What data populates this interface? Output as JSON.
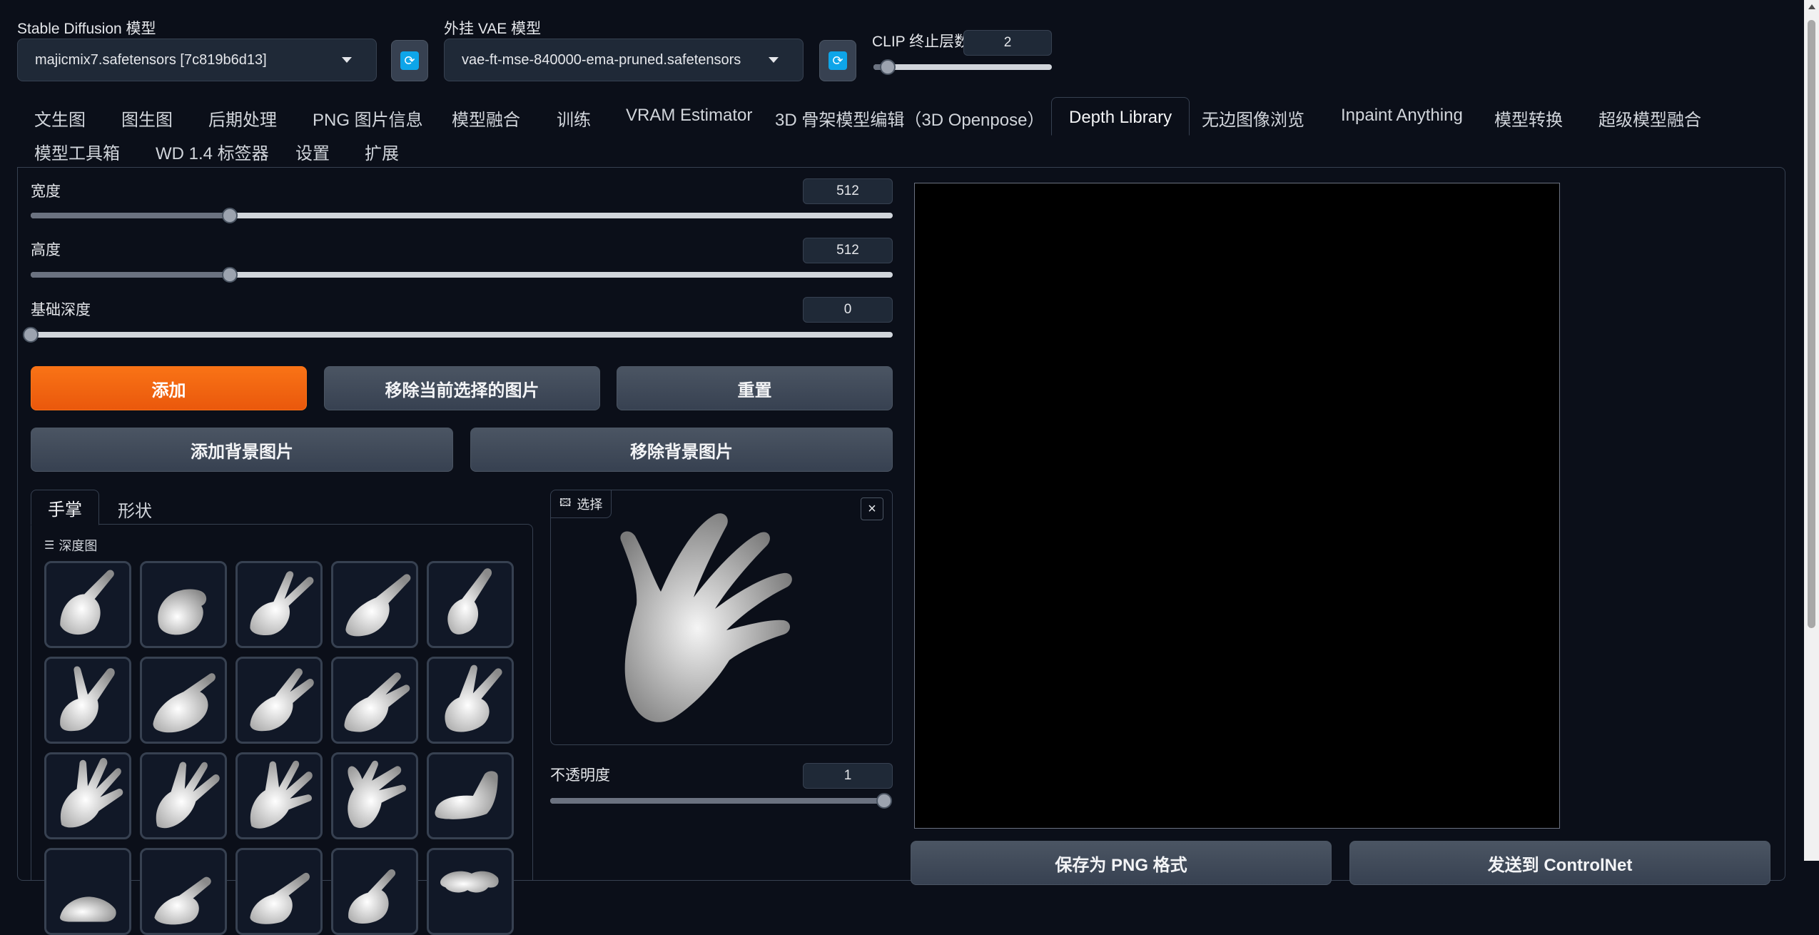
{
  "top": {
    "sd_model_label": "Stable Diffusion 模型",
    "sd_model_value": "majicmix7.safetensors [7c819b6d13]",
    "vae_label": "外挂 VAE 模型",
    "vae_value": "vae-ft-mse-840000-ema-pruned.safetensors",
    "clip_label": "CLIP 终止层数",
    "clip_value": "2",
    "clip_slider_fraction": 0.08
  },
  "tabs": [
    {
      "label": "文生图"
    },
    {
      "label": "图生图"
    },
    {
      "label": "后期处理"
    },
    {
      "label": "PNG 图片信息"
    },
    {
      "label": "模型融合"
    },
    {
      "label": "训练"
    },
    {
      "label": "VRAM Estimator"
    },
    {
      "label": "3D 骨架模型编辑（3D Openpose）"
    },
    {
      "label": "Depth Library"
    },
    {
      "label": "无边图像浏览"
    },
    {
      "label": "Inpaint Anything"
    },
    {
      "label": "模型转换"
    },
    {
      "label": "超级模型融合"
    },
    {
      "label": "模型工具箱"
    },
    {
      "label": "WD 1.4 标签器"
    },
    {
      "label": "设置"
    },
    {
      "label": "扩展"
    }
  ],
  "active_tab": "Depth Library",
  "controls": {
    "width_label": "宽度",
    "width_value": "512",
    "width_fraction": 0.231,
    "height_label": "高度",
    "height_value": "512",
    "height_fraction": 0.231,
    "base_depth_label": "基础深度",
    "base_depth_value": "0",
    "base_depth_fraction": 0.0
  },
  "buttons": {
    "add": "添加",
    "remove_selected": "移除当前选择的图片",
    "reset": "重置",
    "add_background": "添加背景图片",
    "remove_background": "移除背景图片",
    "save_png": "保存为 PNG 格式",
    "send_controlnet": "发送到 ControlNet"
  },
  "library": {
    "tabs": [
      {
        "label": "手掌"
      },
      {
        "label": "形状"
      }
    ],
    "gallery_label": "深度图"
  },
  "preview": {
    "select_label": "选择",
    "opacity_label": "不透明度",
    "opacity_value": "1",
    "opacity_fraction": 1.0
  },
  "colors": {
    "background": "#0b0f19",
    "accent": "#f97316",
    "refresh_icon": "#0ea5e9"
  }
}
